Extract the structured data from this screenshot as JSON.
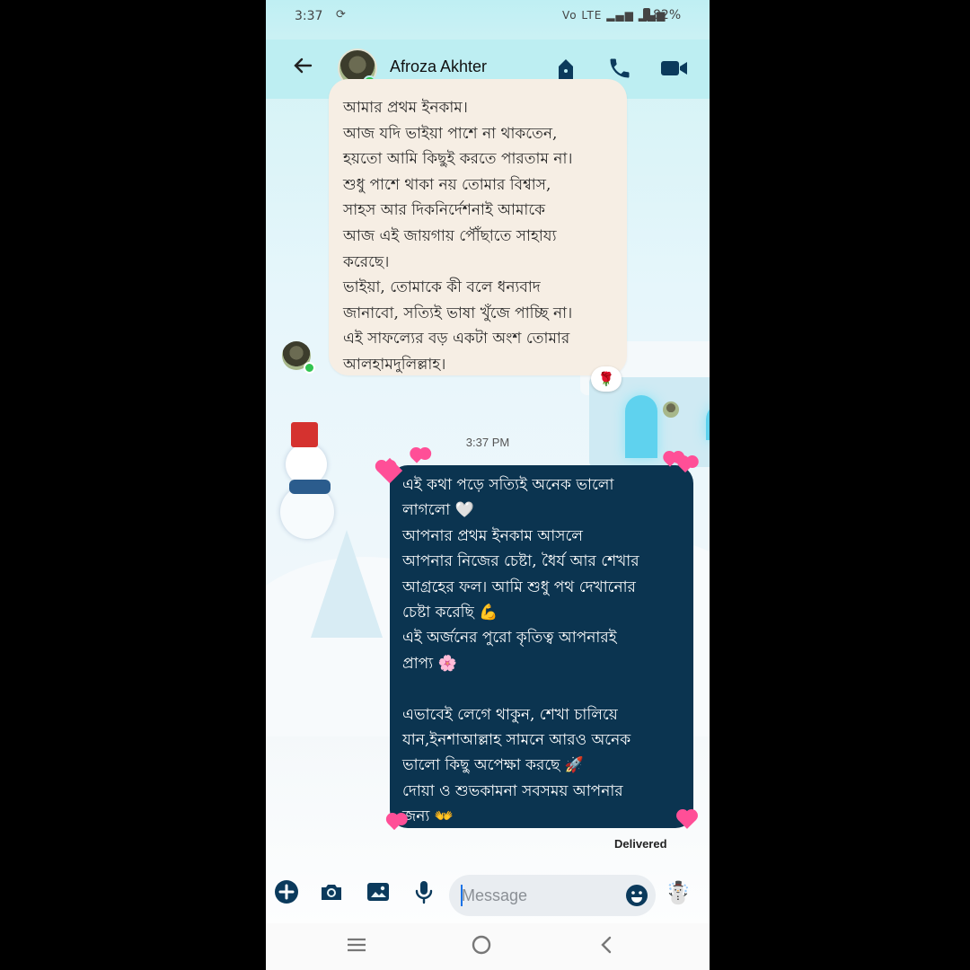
{
  "status_bar": {
    "time": "3:37",
    "sync_icon": "sync-icon",
    "signals_text": "Vo LTE",
    "battery": "82%"
  },
  "header": {
    "contact_name": "Afroza Akhter",
    "icons": [
      "back-arrow-icon",
      "lock-icon",
      "phone-icon",
      "video-icon"
    ]
  },
  "messages": {
    "incoming_text": "আমার প্রথম ইনকাম।\nআজ যদি ভাইয়া পাশে না থাকতেন,\nহয়তো আমি কিছুই করতে পারতাম না।\nশুধু পাশে থাকা নয় তোমার বিশ্বাস,\nসাহস আর দিকনির্দেশনাই আমাকে\nআজ এই জায়গায় পৌঁছাতে সাহায্য\nকরেছে।\nভাইয়া, তোমাকে কী বলে ধন্যবাদ\nজানাবো, সত্যিই ভাষা খুঁজে পাচ্ছি না।\nএই সাফল্যের বড় একটা অংশ তোমার\nআলহামদুলিল্লাহ।",
    "reaction": "🌹",
    "timestamp": "3:37 PM",
    "outgoing_text": "এই কথা পড়ে সত্যিই অনেক ভালো\nলাগলো 🤍\nআপনার প্রথম ইনকাম আসলে\nআপনার নিজের চেষ্টা, ধৈর্য আর শেখার\nআগ্রহের ফল। আমি শুধু পথ দেখানোর\nচেষ্টা করেছি 💪\nএই অর্জনের পুরো কৃতিত্ব আপনারই\nপ্রাপ্য 🌸\n\nএভাবেই লেগে থাকুন, শেখা চালিয়ে\nযান,ইনশাআল্লাহ সামনে আরও অনেক\nভালো কিছু অপেক্ষা করছে 🚀\nদোয়া ও শুভকামনা সবসময় আপনার\nজন্য 👐",
    "delivered": "Delivered"
  },
  "composer": {
    "placeholder": "Message",
    "quick_emoji": "☃️"
  },
  "colors": {
    "header_bg": "#bdeef2",
    "outgoing_bubble": "#0b3450",
    "incoming_bubble": "#f6eee4",
    "accent": "#0b3a5c"
  }
}
